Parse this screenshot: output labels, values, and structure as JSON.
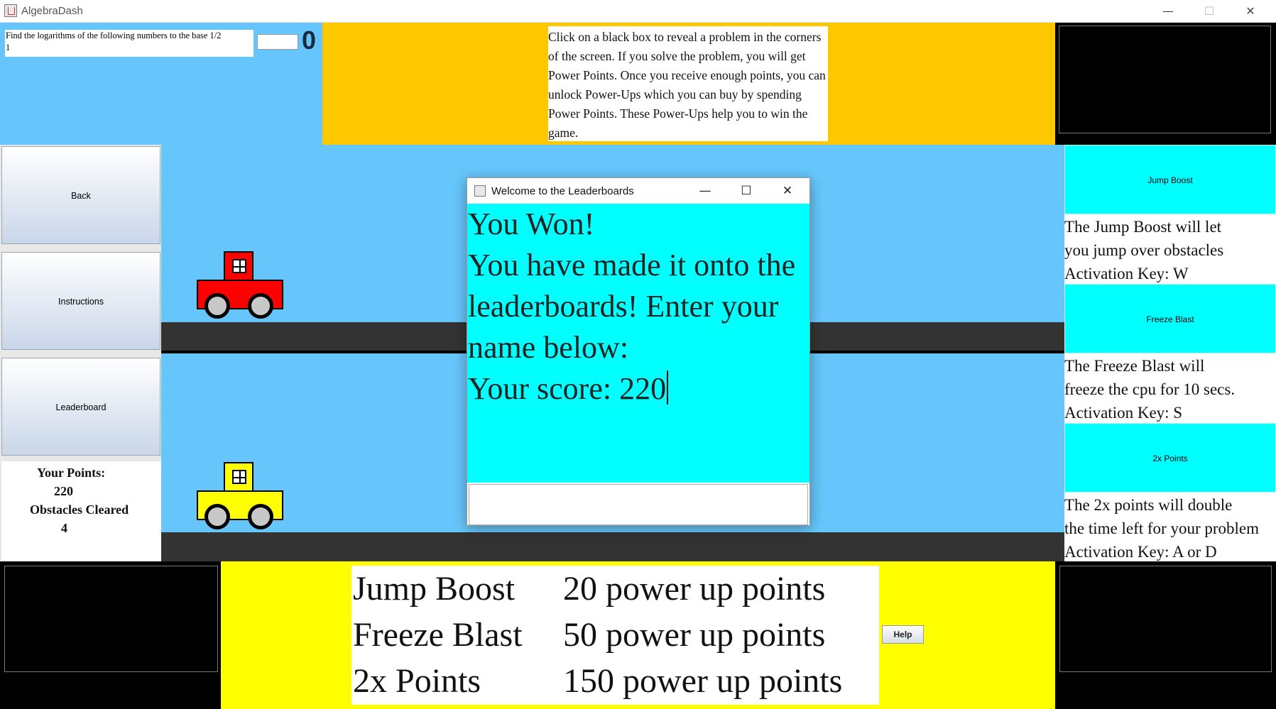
{
  "window": {
    "title": "AlgebraDash",
    "minimize": "—",
    "maximize": "☐",
    "close": "✕"
  },
  "problem": {
    "line1": "Find the logarithms of the following numbers to the base 1/2",
    "line2": "1",
    "answer_value": "",
    "counter": "0"
  },
  "info_text": "Click on a black box to reveal a problem in the corners of the screen. If you solve the problem, you will get Power Points. Once you receive enough points, you can unlock Power-Ups which you can buy by spending Power Points. These Power-Ups help you to win the game.",
  "left_menu": {
    "back": "Back",
    "instructions": "Instructions",
    "leaderboard": "Leaderboard"
  },
  "stats": {
    "points_label": "Your Points:",
    "points_value": "220",
    "obstacles_label": "Obstacles Cleared",
    "obstacles_value": "4"
  },
  "power_ups": [
    {
      "button": "Jump Boost",
      "desc_lines": [
        "The Jump Boost will let",
        "you jump over obstacles",
        "Activation Key: W"
      ]
    },
    {
      "button": "Freeze Blast",
      "desc_lines": [
        "The Freeze Blast will",
        "freeze the cpu for 10 secs.",
        "Activation Key: S"
      ]
    },
    {
      "button": "2x Points",
      "desc_lines": [
        "The 2x points will double",
        "the time left for your problem",
        "Activation Key: A or D"
      ]
    }
  ],
  "prices": [
    {
      "name": "Jump Boost",
      "cost": "20 power up points"
    },
    {
      "name": "Freeze Blast",
      "cost": "50 power up points"
    },
    {
      "name": "2x Points",
      "cost": "150 power up points"
    }
  ],
  "help_label": "Help",
  "dialog": {
    "title": "Welcome to the Leaderboards",
    "minimize": "—",
    "maximize": "☐",
    "close": "✕",
    "line1": "You Won!",
    "line2": "You have made it onto the",
    "line3": "leaderboards! Enter your",
    "line4": "name below:",
    "line5": "Your score: 220",
    "name_value": ""
  },
  "colors": {
    "sky": "#66c6fb",
    "top_banner": "#fec800",
    "bottom_banner": "#ffff00",
    "powerup_cyan": "#00ffff",
    "player_car": "#ff0000",
    "cpu_car": "#ffff00"
  },
  "icons": [
    "java-cup-icon",
    "minimize-icon",
    "maximize-icon",
    "close-icon"
  ]
}
